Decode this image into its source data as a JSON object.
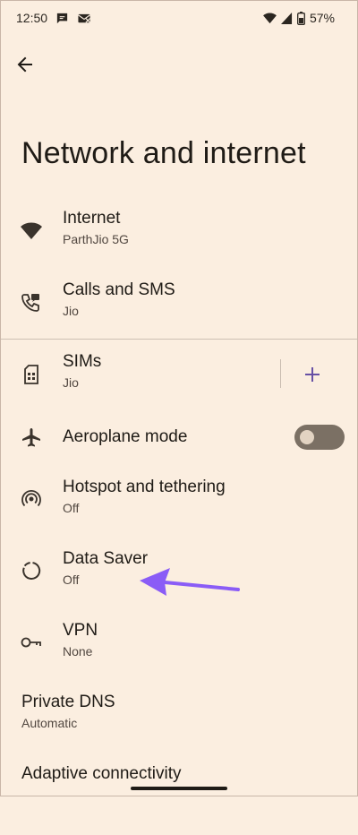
{
  "status_bar": {
    "time": "12:50",
    "battery": "57%"
  },
  "page": {
    "title": "Network and internet"
  },
  "items": [
    {
      "title": "Internet",
      "subtitle": "ParthJio 5G",
      "icon": "wifi-icon"
    },
    {
      "title": "Calls and SMS",
      "subtitle": "Jio",
      "icon": "calls-sms-icon"
    },
    {
      "title": "SIMs",
      "subtitle": "Jio",
      "icon": "sim-card-icon"
    },
    {
      "title": "Aeroplane mode",
      "icon": "airplane-icon",
      "toggle_on": false
    },
    {
      "title": "Hotspot and tethering",
      "subtitle": "Off",
      "icon": "hotspot-icon"
    },
    {
      "title": "Data Saver",
      "subtitle": "Off",
      "icon": "data-saver-icon"
    },
    {
      "title": "VPN",
      "subtitle": "None",
      "icon": "vpn-key-icon"
    },
    {
      "title": "Private DNS",
      "subtitle": "Automatic"
    },
    {
      "title": "Adaptive connectivity"
    }
  ],
  "colors": {
    "background": "#fbeee0",
    "accent": "#6750a4",
    "annotation_arrow": "#8a5cf6"
  }
}
